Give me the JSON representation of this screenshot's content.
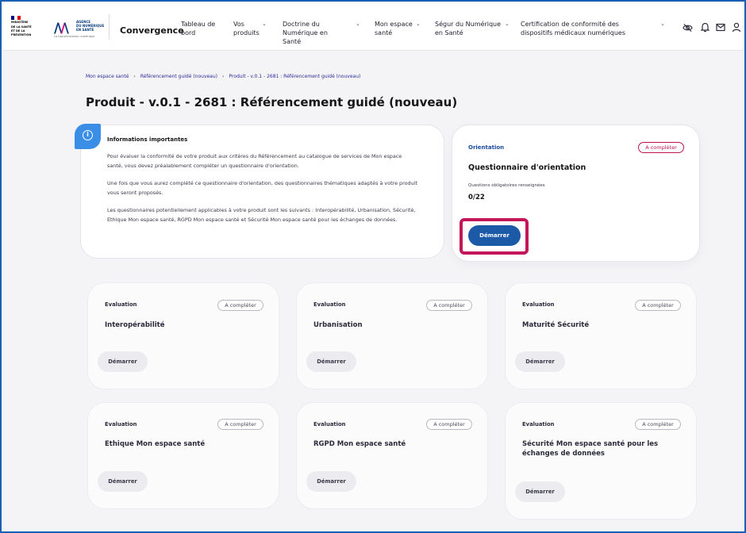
{
  "header": {
    "republic_logo_text": [
      "MINISTÈRE",
      "DE LA SANTÉ",
      "ET DE LA PRÉVENTION"
    ],
    "ans_logo_text": [
      "AGENCE",
      "DU NUMÉRIQUE",
      "EN SANTÉ"
    ],
    "ans_tagline": "La transformation numérique",
    "brand": "Convergence",
    "nav": [
      {
        "label": "Tableau de bord",
        "has_chevron": false
      },
      {
        "label": "Vos produits",
        "has_chevron": true
      },
      {
        "label": "Doctrine du Numérique en Santé",
        "has_chevron": true
      },
      {
        "label": "Mon espace santé",
        "has_chevron": true
      },
      {
        "label": "Ségur du Numérique en Santé",
        "has_chevron": true
      },
      {
        "label": "Certification de conformité des dispositifs médicaux numériques",
        "has_chevron": true
      }
    ],
    "icons": [
      "eye-off-icon",
      "bell-icon",
      "mail-icon",
      "user-icon"
    ]
  },
  "breadcrumb": [
    "Mon espace santé",
    "Référencement guidé (nouveau)",
    "Produit - v.0.1 - 2681 : Référencement guidé (nouveau)"
  ],
  "page_title": "Produit - v.0.1 - 2681 : Référencement guidé (nouveau)",
  "info": {
    "title": "Informations importantes",
    "paragraphs": [
      "Pour évaluer la conformité de votre produit aux critères du Référencement au catalogue de services de Mon espace santé, vous devez préalablement compléter un questionnaire d'orientation.",
      "Une fois que vous aurez complété ce questionnaire d'orientation, des questionnaires thématiques adaptés à votre produit vous seront proposés.",
      "Les questionnaires potentiellement applicables à votre produit sont les suivants : Interopérabilité, Urbanisation, Sécurité, Ethique Mon espace santé, RGPD Mon espace santé et Sécurité Mon espace santé pour les échanges de données."
    ]
  },
  "orientation": {
    "label": "Orientation",
    "status": "A compléter",
    "title": "Questionnaire d'orientation",
    "subtitle": "Questions obligatoires renseignées",
    "count": "0/22",
    "button": "Démarrer"
  },
  "evaluations": [
    {
      "label": "Evaluation",
      "status": "A compléter",
      "title": "Interopérabilité",
      "button": "Démarrer"
    },
    {
      "label": "Evaluation",
      "status": "A compléter",
      "title": "Urbanisation",
      "button": "Démarrer"
    },
    {
      "label": "Evaluation",
      "status": "A compléter",
      "title": "Maturité Sécurité",
      "button": "Démarrer"
    },
    {
      "label": "Evaluation",
      "status": "A compléter",
      "title": "Ethique Mon espace santé",
      "button": "Démarrer"
    },
    {
      "label": "Evaluation",
      "status": "A compléter",
      "title": "RGPD Mon espace santé",
      "button": "Démarrer"
    },
    {
      "label": "Evaluation",
      "status": "A compléter",
      "title": "Sécurité Mon espace santé pour les échanges de données",
      "button": "Démarrer"
    }
  ],
  "colors": {
    "primary": "#1c5aa8",
    "highlight": "#c4175b",
    "status_red": "#c0134c",
    "info_blue": "#3a8ee6"
  }
}
